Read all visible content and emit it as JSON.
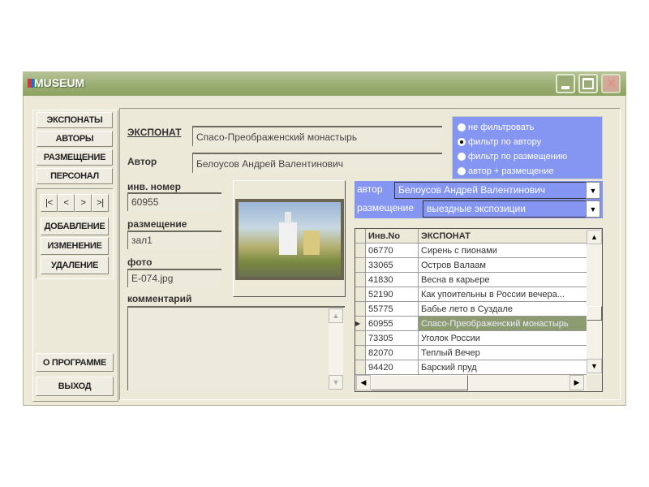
{
  "window": {
    "title": "MUSEUM"
  },
  "sidebar": {
    "top_buttons": [
      "ЭКСПОНАТЫ",
      "АВТОРЫ",
      "РАЗМЕЩЕНИЕ",
      "ПЕРСОНАЛ"
    ],
    "nav": [
      "|<",
      "<",
      ">",
      ">|"
    ],
    "actions": [
      "ДОБАВЛЕНИЕ",
      "ИЗМЕНЕНИЕ",
      "УДАЛЕНИЕ"
    ],
    "about": "О ПРОГРАММЕ",
    "exit": "ВЫХОД"
  },
  "form": {
    "exhibit_label": "ЭКСПОНАТ",
    "exhibit_value": "Спасо-Преображенский монастырь",
    "author_label": "Автор",
    "author_value": "Белоусов Андрей Валентинович",
    "inv_label": "инв. номер",
    "inv_value": "60955",
    "place_label": "размещение",
    "place_value": "зал1",
    "photo_label": "фото",
    "photo_value": "E-074.jpg",
    "comment_label": "комментарий",
    "comment_value": ""
  },
  "filter": {
    "options": [
      "не фильтровать",
      "фильтр по автору",
      "фильтр по размещению",
      "автор + размещение"
    ],
    "selected": 1,
    "author_label": "автор",
    "author_value": "Белоусов Андрей Валентинович",
    "place_label": "размещение",
    "place_value": "выездные экспозиции"
  },
  "grid": {
    "headers": [
      "Инв.No",
      "ЭКСПОНАТ"
    ],
    "selected": 5,
    "rows": [
      [
        "06770",
        "Сирень с пионами"
      ],
      [
        "33065",
        "Остров Валаам"
      ],
      [
        "41830",
        "Весна в карьере"
      ],
      [
        "52190",
        "Как упоительны в России вечера..."
      ],
      [
        "55775",
        "Бабье лето в Суздале"
      ],
      [
        "60955",
        "Спасо-Преображенский монастырь"
      ],
      [
        "73305",
        "Уголок России"
      ],
      [
        "82070",
        "Теплый Вечер"
      ],
      [
        "94420",
        "Барский пруд"
      ]
    ]
  }
}
